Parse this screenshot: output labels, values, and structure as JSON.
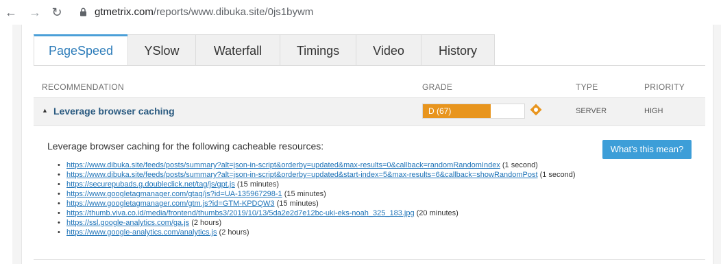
{
  "browser": {
    "url_host": "gtmetrix.com",
    "url_path": "/reports/www.dibuka.site/0js1bywm"
  },
  "tabs": [
    {
      "label": "PageSpeed",
      "active": true
    },
    {
      "label": "YSlow",
      "active": false
    },
    {
      "label": "Waterfall",
      "active": false
    },
    {
      "label": "Timings",
      "active": false
    },
    {
      "label": "Video",
      "active": false
    },
    {
      "label": "History",
      "active": false
    }
  ],
  "table": {
    "headers": {
      "recommendation": "RECOMMENDATION",
      "grade": "GRADE",
      "type": "TYPE",
      "priority": "PRIORITY"
    },
    "row": {
      "title": "Leverage browser caching",
      "grade_text": "D (67)",
      "grade_value": 67,
      "grade_color": "#e8951e",
      "type": "SERVER",
      "priority": "HIGH"
    }
  },
  "details": {
    "intro": "Leverage browser caching for the following cacheable resources:",
    "help_button": "What's this mean?",
    "resources": [
      {
        "url": "https://www.dibuka.site/feeds/posts/summary?alt=json-in-script&orderby=updated&max-results=0&callback=randomRandomIndex",
        "duration": "(1 second)"
      },
      {
        "url": "https://www.dibuka.site/feeds/posts/summary?alt=json-in-script&orderby=updated&start-index=5&max-results=6&callback=showRandomPost",
        "duration": "(1 second)"
      },
      {
        "url": "https://securepubads.g.doubleclick.net/tag/js/gpt.js",
        "duration": "(15 minutes)"
      },
      {
        "url": "https://www.googletagmanager.com/gtag/js?id=UA-135967298-1",
        "duration": "(15 minutes)"
      },
      {
        "url": "https://www.googletagmanager.com/gtm.js?id=GTM-KPDQW3",
        "duration": "(15 minutes)"
      },
      {
        "url": "https://thumb.viva.co.id/media/frontend/thumbs3/2019/10/13/5da2e2d7e12bc-uki-eks-noah_325_183.jpg",
        "duration": "(20 minutes)"
      },
      {
        "url": "https://ssl.google-analytics.com/ga.js",
        "duration": "(2 hours)"
      },
      {
        "url": "https://www.google-analytics.com/analytics.js",
        "duration": "(2 hours)"
      }
    ]
  }
}
